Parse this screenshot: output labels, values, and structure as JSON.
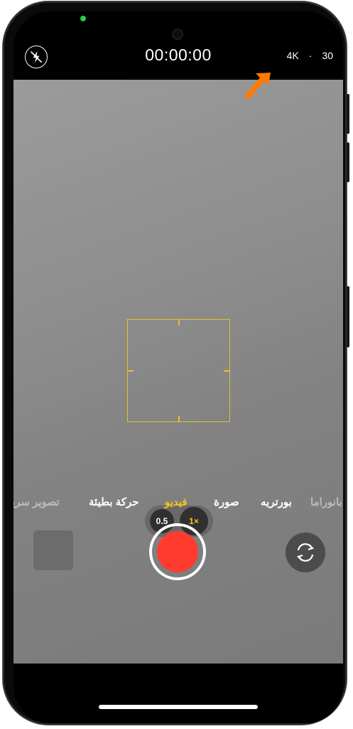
{
  "app": "Camera",
  "header": {
    "recording_time": "00:00:00",
    "resolution": "4K",
    "separator": "·",
    "fps": "30"
  },
  "zoom": {
    "option_wide": "0.5",
    "option_main": "1×",
    "selected": "1×"
  },
  "modes": {
    "items": [
      "تصوير سريع",
      "حركة بطيئة",
      "فيديو",
      "صورة",
      "بورتريه",
      "بانوراما"
    ],
    "selected": "فيديو"
  },
  "icons": {
    "flash": "flash-off-icon",
    "arrow": "annotation-arrow-icon",
    "flip": "camera-flip-icon"
  },
  "colors": {
    "accent": "#f5c518",
    "record": "#ff3b30",
    "focus_box": "#e6c12a",
    "annotation": "#ff7a00"
  }
}
